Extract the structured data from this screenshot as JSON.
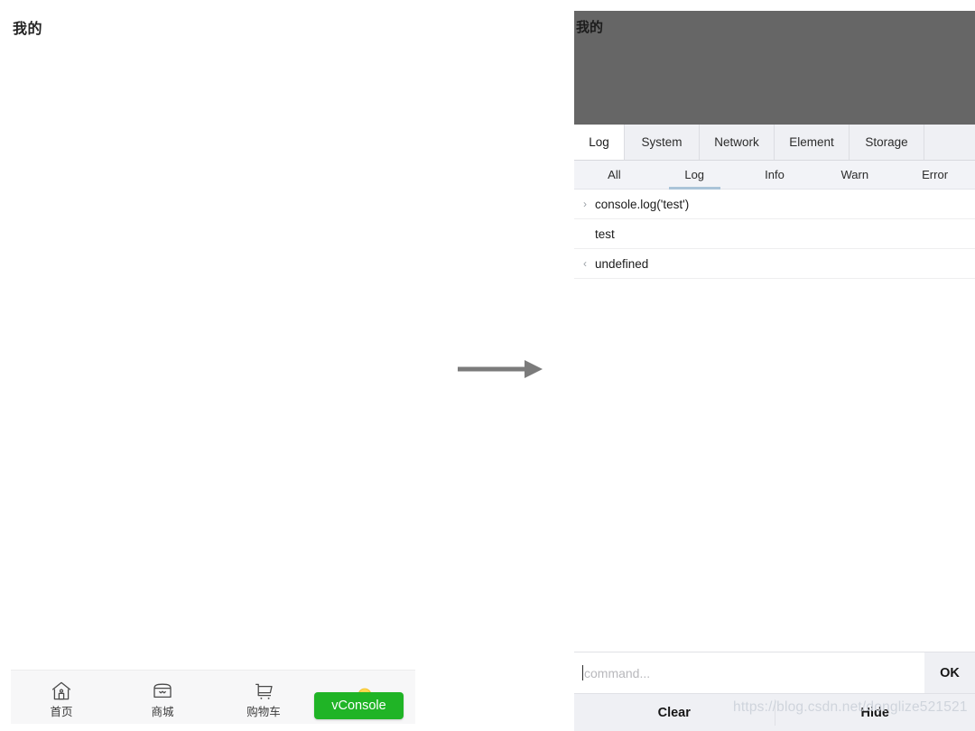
{
  "left_screen": {
    "page_title": "我的",
    "tabbar": [
      {
        "label": "首页",
        "icon": "home-icon"
      },
      {
        "label": "商城",
        "icon": "store-icon"
      },
      {
        "label": "购物车",
        "icon": "shopping-cart-icon"
      },
      {
        "label": "",
        "icon": "user-avatar-icon"
      }
    ],
    "vconsole_button": {
      "label": "vConsole",
      "color": "#20b426"
    }
  },
  "arrow": {
    "name": "right-arrow",
    "color": "#7b7b7b"
  },
  "vconsole_panel": {
    "masked_page_title": "我的",
    "mask_color": "#666666",
    "tabs": [
      {
        "label": "Log",
        "active": true
      },
      {
        "label": "System",
        "active": false
      },
      {
        "label": "Network",
        "active": false
      },
      {
        "label": "Element",
        "active": false
      },
      {
        "label": "Storage",
        "active": false
      },
      {
        "label": "",
        "active": false
      }
    ],
    "filters": [
      {
        "label": "All",
        "active": false
      },
      {
        "label": "Log",
        "active": true
      },
      {
        "label": "Info",
        "active": false
      },
      {
        "label": "Warn",
        "active": false
      },
      {
        "label": "Error",
        "active": false
      }
    ],
    "filter_active_color": "#aac4d8",
    "log_rows": [
      {
        "caret": "›",
        "text": "console.log('test')"
      },
      {
        "caret": "",
        "text": "test"
      },
      {
        "caret": "‹",
        "text": "undefined"
      }
    ],
    "command_bar": {
      "placeholder": "command...",
      "value": "",
      "ok_label": "OK"
    },
    "footer": {
      "clear_label": "Clear",
      "hide_label": "Hide"
    }
  },
  "watermark": {
    "text": "https://blog.csdn.net/donglize521521"
  }
}
